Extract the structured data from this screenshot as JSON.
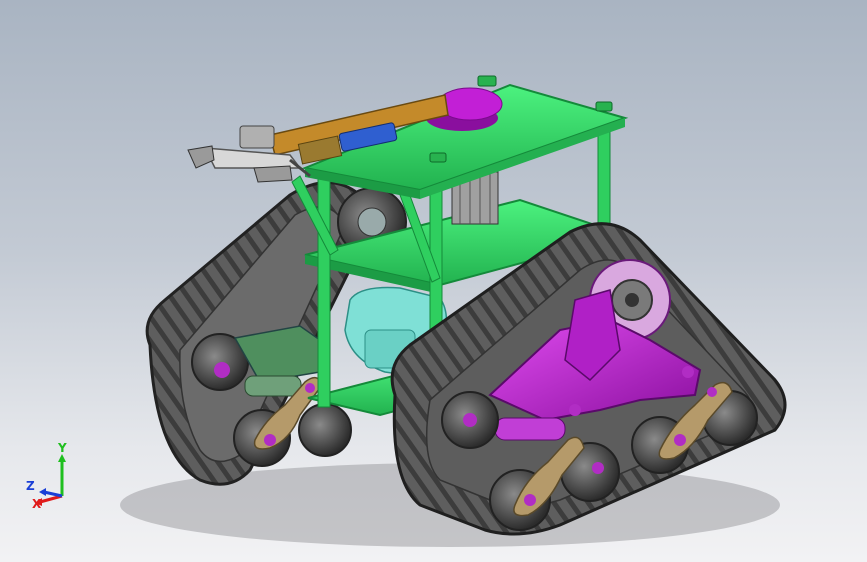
{
  "viewport": {
    "title": ""
  },
  "triad": {
    "y_label": "Y",
    "z_label": "Z",
    "x_label": "X",
    "colors": {
      "x": "#e01b1b",
      "y": "#1fbf1f",
      "z": "#1a3fd6"
    }
  },
  "model": {
    "colors": {
      "track": "#4a4a4a",
      "track_dark": "#2b2b2b",
      "frame_green": "#33e06b",
      "frame_green_dark": "#1ea24a",
      "suspension_magenta": "#c21fd6",
      "suspension_magenta_dark": "#8a0f9e",
      "bogie_tan": "#b59a6a",
      "arm_orange": "#c48a2a",
      "motor_cyan": "#7fe0d6",
      "gripper_gray": "#9a9a9a"
    }
  }
}
